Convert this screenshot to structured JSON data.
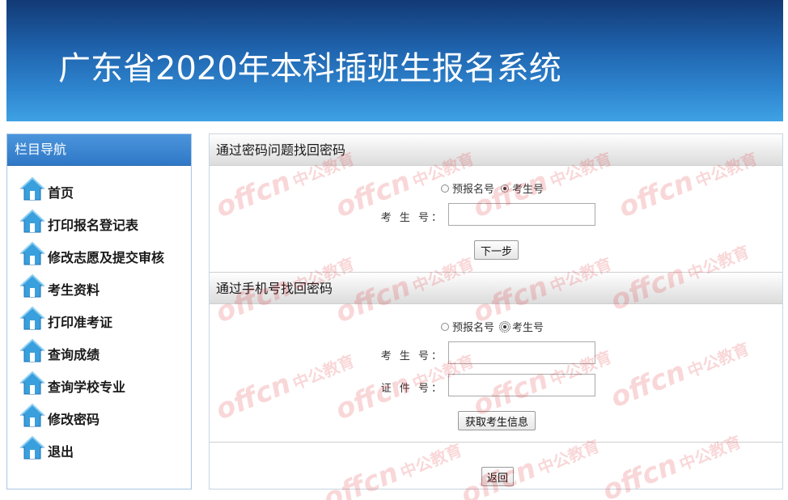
{
  "header": {
    "title": "广东省2020年本科插班生报名系统"
  },
  "sidebar": {
    "title": "栏目导航",
    "items": [
      {
        "label": "首页",
        "icon": "home-icon"
      },
      {
        "label": "打印报名登记表",
        "icon": "home-icon"
      },
      {
        "label": "修改志愿及提交审核",
        "icon": "home-icon"
      },
      {
        "label": "考生资料",
        "icon": "home-icon"
      },
      {
        "label": "打印准考证",
        "icon": "home-icon"
      },
      {
        "label": "查询成绩",
        "icon": "home-icon"
      },
      {
        "label": "查询学校专业",
        "icon": "home-icon"
      },
      {
        "label": "修改密码",
        "icon": "home-icon"
      },
      {
        "label": "退出",
        "icon": "home-icon"
      }
    ]
  },
  "section_question": {
    "title": "通过密码问题找回密码",
    "radio_options": [
      "预报名号",
      "考生号"
    ],
    "selected": "考生号",
    "exam_no_label": "考 生 号：",
    "exam_no_value": "",
    "next_button": "下一步"
  },
  "section_phone": {
    "title": "通过手机号找回密码",
    "radio_options": [
      "预报名号",
      "考生号"
    ],
    "selected": "考生号",
    "exam_no_label": "考 生 号：",
    "exam_no_value": "",
    "id_label": "证 件 号：",
    "id_value": "",
    "get_info_button": "获取考生信息"
  },
  "footer": {
    "back_button": "返回"
  },
  "watermark": {
    "brand": "offcn",
    "text": "中公教育"
  },
  "colors": {
    "header_gradient_top": "#123a75",
    "header_gradient_bottom": "#3fa2e4",
    "sidebar_header": "#2f78c6",
    "watermark": "#e0262d"
  }
}
